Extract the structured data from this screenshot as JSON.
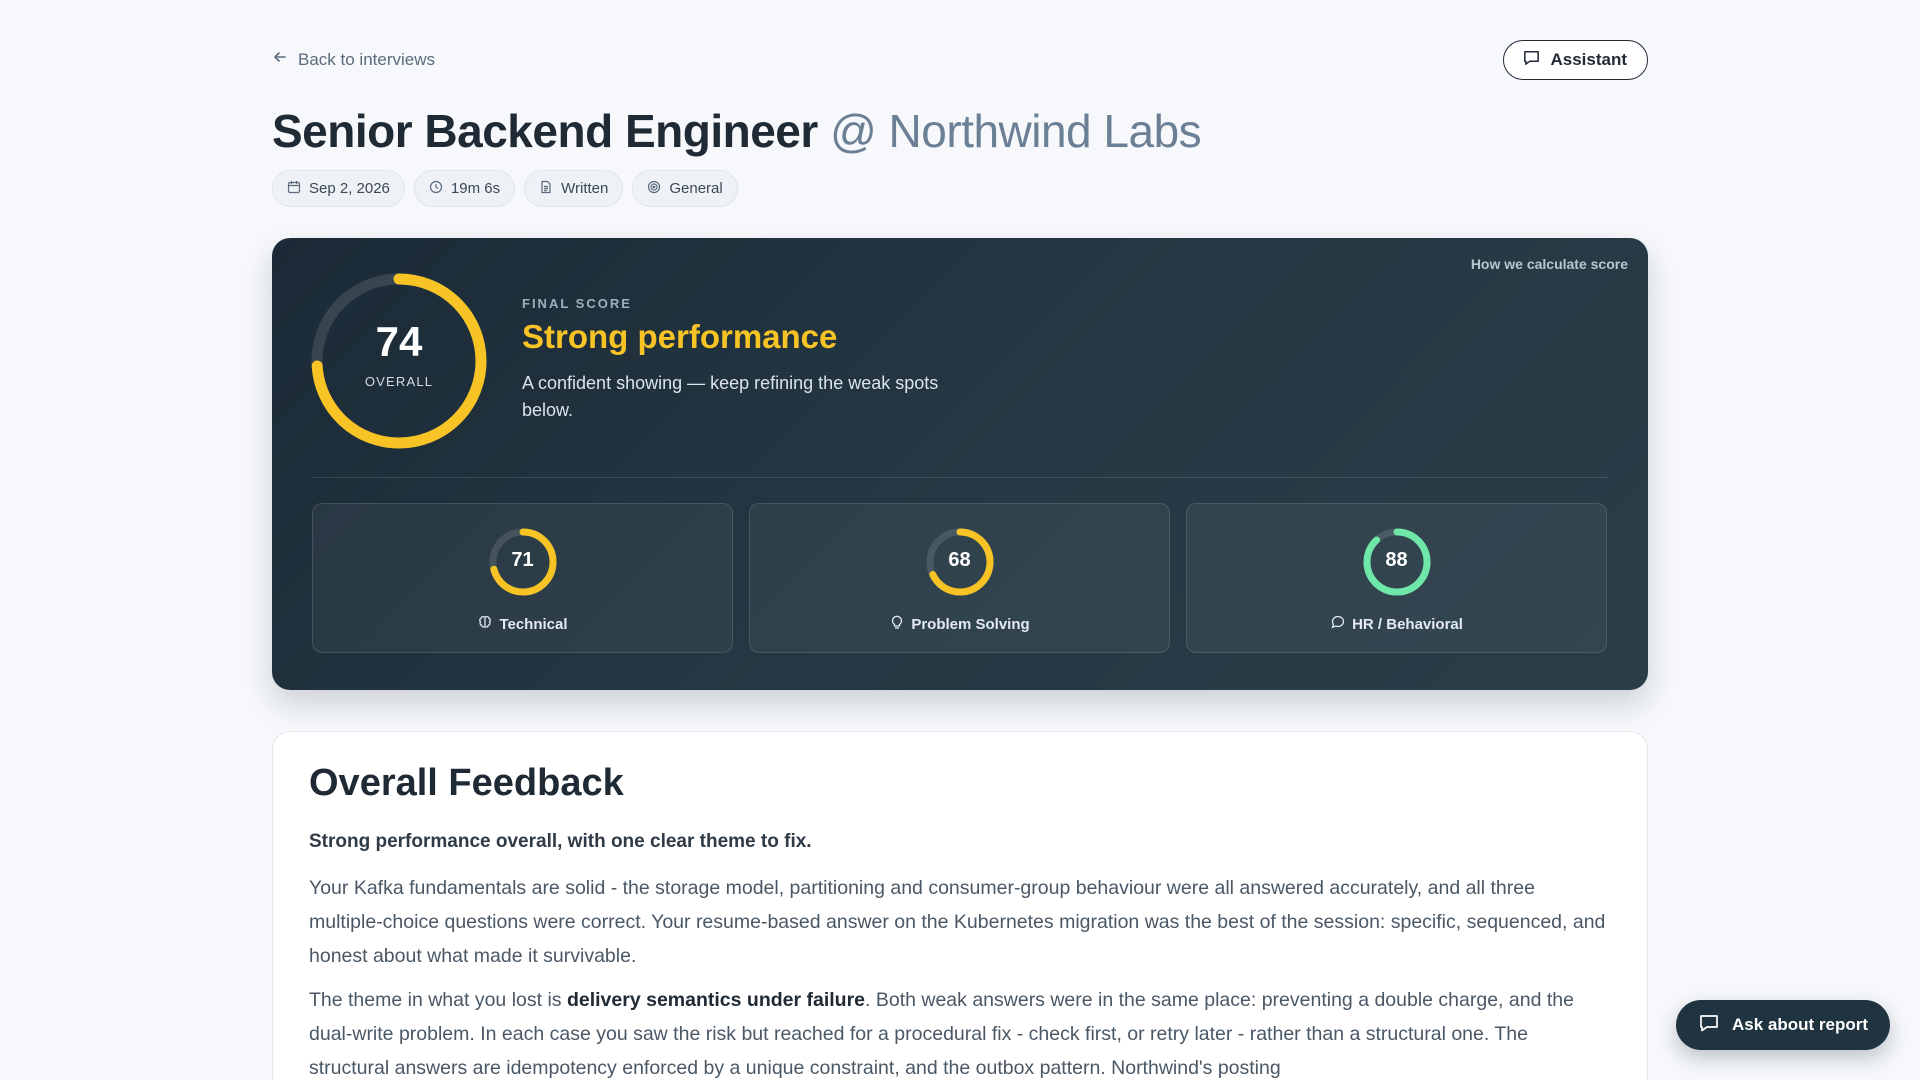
{
  "nav": {
    "back_label": "Back to interviews",
    "assistant_label": "Assistant"
  },
  "header": {
    "role": "Senior Backend Engineer",
    "company": "@ Northwind Labs",
    "chips": [
      {
        "icon": "calendar-icon",
        "label": "Sep 2, 2026"
      },
      {
        "icon": "clock-icon",
        "label": "19m 6s"
      },
      {
        "icon": "document-icon",
        "label": "Written"
      },
      {
        "icon": "target-icon",
        "label": "General"
      }
    ]
  },
  "score": {
    "calc_link": "How we calculate score",
    "overall": 74,
    "overall_label": "OVERALL",
    "final_label": "FINAL SCORE",
    "verdict": "Strong performance",
    "verdict_sub": "A confident showing — keep refining the weak spots below.",
    "ring_color": "#f7c325",
    "categories": [
      {
        "label": "Technical",
        "value": 71,
        "color": "#f7c325",
        "icon": "brain-icon"
      },
      {
        "label": "Problem Solving",
        "value": 68,
        "color": "#f7c325",
        "icon": "lightbulb-icon"
      },
      {
        "label": "HR / Behavioral",
        "value": 88,
        "color": "#6ee7a8",
        "icon": "chat-bubble-icon"
      }
    ]
  },
  "feedback": {
    "title": "Overall Feedback",
    "lead": "Strong performance overall, with one clear theme to fix.",
    "p1": "Your Kafka fundamentals are solid - the storage model, partitioning and consumer-group behaviour were all answered accurately, and all three multiple-choice questions were correct. Your resume-based answer on the Kubernetes migration was the best of the session: specific, sequenced, and honest about what made it survivable.",
    "p2_before": "The theme in what you lost is ",
    "p2_strong": "delivery semantics under failure",
    "p2_after": ". Both weak answers were in the same place: preventing a double charge, and the dual-write problem. In each case you saw the risk but reached for a procedural fix - check first, or retry later - rather than a structural one. The structural answers are idempotency enforced by a unique constraint, and the outbox pattern. Northwind's posting"
  },
  "fab": {
    "ask_label": "Ask about report"
  }
}
